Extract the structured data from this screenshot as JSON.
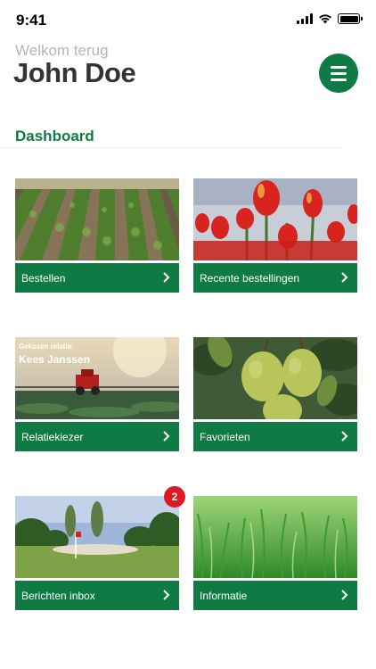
{
  "status_bar": {
    "time": "9:41"
  },
  "header": {
    "welcome": "Welkom terug",
    "user_name": "John Doe"
  },
  "section": {
    "title": "Dashboard"
  },
  "tiles": [
    {
      "label": "Bestellen",
      "image": "potato-field"
    },
    {
      "label": "Recente bestellingen",
      "image": "tulips"
    },
    {
      "label": "Relatiekiezer",
      "image": "sprayer-field",
      "overlay_label": "Gekozen relatie:",
      "overlay_name": "Kees Janssen"
    },
    {
      "label": "Favorieten",
      "image": "pears"
    },
    {
      "label": "Berichten inbox",
      "image": "golf-course",
      "badge": "2"
    },
    {
      "label": "Informatie",
      "image": "grass"
    }
  ],
  "colors": {
    "accent": "#0f7a44",
    "badge": "#e01a22"
  }
}
